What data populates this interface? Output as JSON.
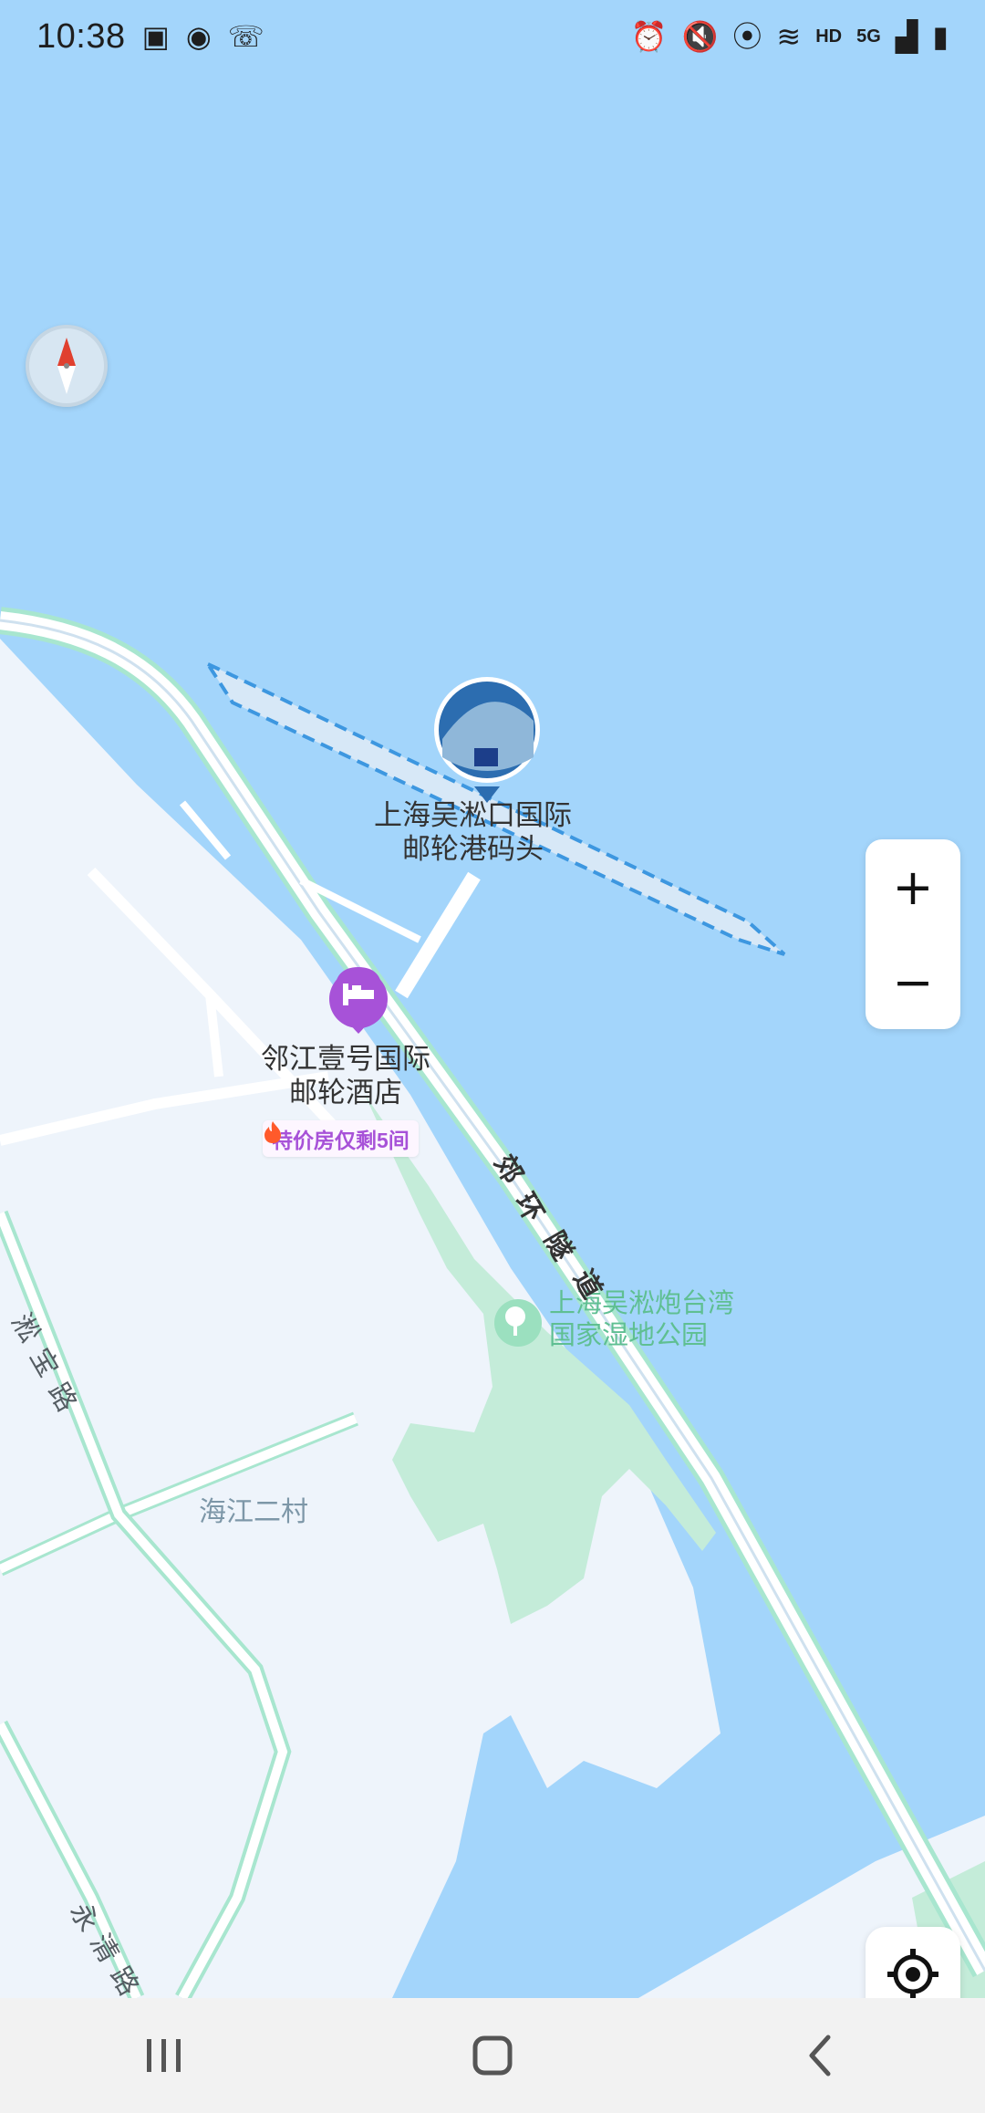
{
  "status_bar": {
    "time": "10:38",
    "left_icons": [
      "gallery-icon",
      "heart-sync-icon",
      "missed-call-icon"
    ],
    "right_icons": [
      "alarm-icon",
      "mute-icon",
      "location-icon",
      "wifi-icon",
      "signal-icon",
      "battery-icon"
    ],
    "hd_label": "HD",
    "network_label": "5G"
  },
  "map": {
    "poi_cruise_terminal": {
      "line1": "上海吴淞口国际",
      "line2": "邮轮港码头"
    },
    "poi_hotel": {
      "line1": "邻江壹号国际",
      "line2": "邮轮酒店"
    },
    "hotel_promo": "特价房仅剩5间",
    "park": {
      "line1": "上海吴淞炮台湾",
      "line2": "国家湿地公园"
    },
    "road_tunnel": [
      "郊",
      "环",
      "隧",
      "道"
    ],
    "road_songbao": [
      "淞",
      "宝",
      "路"
    ],
    "road_yongqing": [
      "永",
      "清",
      "路"
    ],
    "area_haijiang": "海江二村"
  },
  "controls": {
    "zoom_in": "+",
    "zoom_out": "−"
  },
  "colors": {
    "water": "#a3d5fb",
    "land": "#eef4fb",
    "park": "#c4ecd9",
    "road_outline": "#a8e6cf",
    "hotel_pin": "#a752d8",
    "pier_dash": "#3d97e0"
  }
}
